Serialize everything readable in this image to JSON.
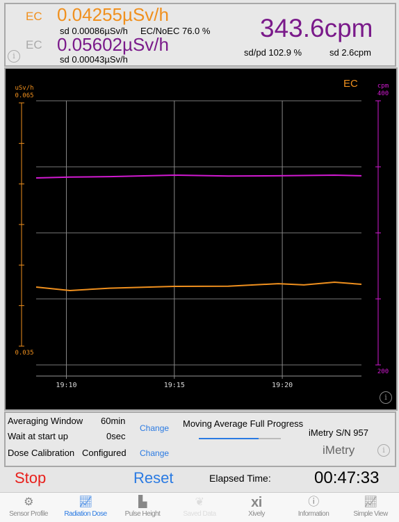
{
  "top": {
    "ec_label": "EC",
    "ec_value": "0.04255µSv/h",
    "ec_sd": "sd 0.00086µSv/h",
    "ec_ratio": "EC/NoEC 76.0 %",
    "noec_label": "EC",
    "noec_value": "0.05602µSv/h",
    "noec_sd": "sd 0.00043µSv/h",
    "cpm": "343.6cpm",
    "sdpd": "sd/pd 102.9 %",
    "cpm_sd": "sd 2.6cpm"
  },
  "colors": {
    "orange": "#f0901e",
    "purple": "#7a1a8a",
    "magenta": "#d21ad2",
    "blue": "#2a7ae2",
    "red": "#e8201c"
  },
  "chart_data": {
    "type": "line",
    "legend": "EC",
    "left_axis": {
      "label": "uSv/h",
      "top": "0.065",
      "bottom": "0.035",
      "ylim": [
        0.035,
        0.065
      ]
    },
    "right_axis": {
      "label": "cpm",
      "top": "400",
      "bottom": "200",
      "ylim": [
        200,
        400
      ]
    },
    "x_ticks": [
      "19:10",
      "19:15",
      "19:20"
    ],
    "xlim": [
      "19:08:36",
      "19:23:40"
    ],
    "grid": true,
    "series": [
      {
        "axis": "left",
        "color": "#f0901e",
        "x": [
          "19:08:36",
          "19:10:10",
          "19:12:00",
          "19:15:00",
          "19:17:30",
          "19:19:49",
          "19:21:00",
          "19:22:25",
          "19:23:40"
        ],
        "values": [
          0.04229,
          0.04186,
          0.04215,
          0.04237,
          0.0424,
          0.04271,
          0.04255,
          0.04289,
          0.04263
        ]
      },
      {
        "axis": "right",
        "color": "#d21ad2",
        "x": [
          "19:08:36",
          "19:10:10",
          "19:12:00",
          "19:15:00",
          "19:17:30",
          "19:19:49",
          "19:22:25",
          "19:23:40"
        ],
        "values": [
          341.6,
          342.2,
          342.6,
          343.7,
          343.0,
          343.2,
          343.7,
          343.2
        ]
      }
    ]
  },
  "settings": {
    "avg_label": "Averaging Window",
    "avg_value": "60min",
    "wait_label": "Wait at start up",
    "wait_value": "0sec",
    "cal_label": "Dose Calibration",
    "cal_value": "Configured",
    "change": "Change",
    "progress_label": "Moving Average Full Progress",
    "progress": 0.73,
    "serial": "iMetry S/N 957",
    "brand": "iMetry"
  },
  "controls": {
    "stop": "Stop",
    "reset": "Reset",
    "elapsed_label": "Elapsed Time:",
    "elapsed": "00:47:33"
  },
  "tabs": [
    {
      "label": "Sensor Profile",
      "icon": "gear-icon"
    },
    {
      "label": "Radiation Dose",
      "icon": "chart-icon"
    },
    {
      "label": "Pulse Height",
      "icon": "histogram-icon"
    },
    {
      "label": "Saved Data",
      "icon": "leaf-icon"
    },
    {
      "label": "Xively",
      "icon": "xi"
    },
    {
      "label": "Information",
      "icon": "exclamation-icon"
    },
    {
      "label": "Simple View",
      "icon": "chart-icon"
    }
  ]
}
